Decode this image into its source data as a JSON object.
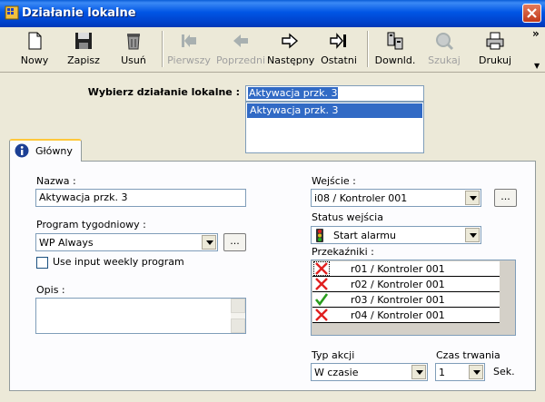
{
  "window": {
    "title": "Działanie lokalne",
    "title_icon": "app-icon",
    "close": "close-icon"
  },
  "toolbar": {
    "buttons": [
      {
        "label": "Nowy",
        "icon": "new-document-icon",
        "enabled": true
      },
      {
        "label": "Zapisz",
        "icon": "floppy-disk-icon",
        "enabled": true
      },
      {
        "label": "Usuń",
        "icon": "trash-icon",
        "enabled": true
      },
      {
        "label": "Pierwszy",
        "icon": "first-record-icon",
        "enabled": false
      },
      {
        "label": "Poprzedni",
        "icon": "previous-record-icon",
        "enabled": false
      },
      {
        "label": "Następny",
        "icon": "next-record-icon",
        "enabled": true
      },
      {
        "label": "Ostatni",
        "icon": "last-record-icon",
        "enabled": true
      },
      {
        "label": "Downld.",
        "icon": "download-icon",
        "enabled": true
      },
      {
        "label": "Szukaj",
        "icon": "search-icon",
        "enabled": false
      },
      {
        "label": "Drukuj",
        "icon": "printer-icon",
        "enabled": true
      }
    ],
    "more": "»"
  },
  "selector": {
    "label": "Wybierz działanie lokalne :",
    "value": "Aktywacja przk. 3",
    "options": [
      "Aktywacja przk. 3"
    ]
  },
  "tabs": [
    {
      "label": "Główny",
      "icon": "info-icon",
      "active": true
    }
  ],
  "form": {
    "name_label": "Nazwa :",
    "name_value": "Aktywacja przk. 3",
    "weekly_label": "Program tygodniowy :",
    "weekly_value": "WP Always",
    "use_input_weekly_label": "Use input weekly program",
    "use_input_weekly_checked": false,
    "desc_label": "Opis :",
    "desc_value": "",
    "input_label": "Wejście :",
    "input_value": "i08 / Kontroler 001",
    "input_status_label": "Status wejścia",
    "input_status_value": "Start alarmu",
    "input_status_icon": "traffic-light-icon",
    "relays_label": "Przekaźniki :",
    "relays": [
      {
        "name": "r01 / Kontroler 001",
        "state": "off"
      },
      {
        "name": "r02 / Kontroler 001",
        "state": "off"
      },
      {
        "name": "r03 / Kontroler 001",
        "state": "on"
      },
      {
        "name": "r04 / Kontroler 001",
        "state": "off"
      }
    ],
    "action_type_label": "Typ akcji",
    "action_type_value": "W czasie",
    "duration_label": "Czas trwania",
    "duration_value": "1",
    "duration_unit": "Sek.",
    "browse_label": "..."
  },
  "colors": {
    "titlebar": "#0055e5",
    "selection": "#316ac5",
    "check_on": "#2a9d1e",
    "check_off": "#e02020"
  }
}
